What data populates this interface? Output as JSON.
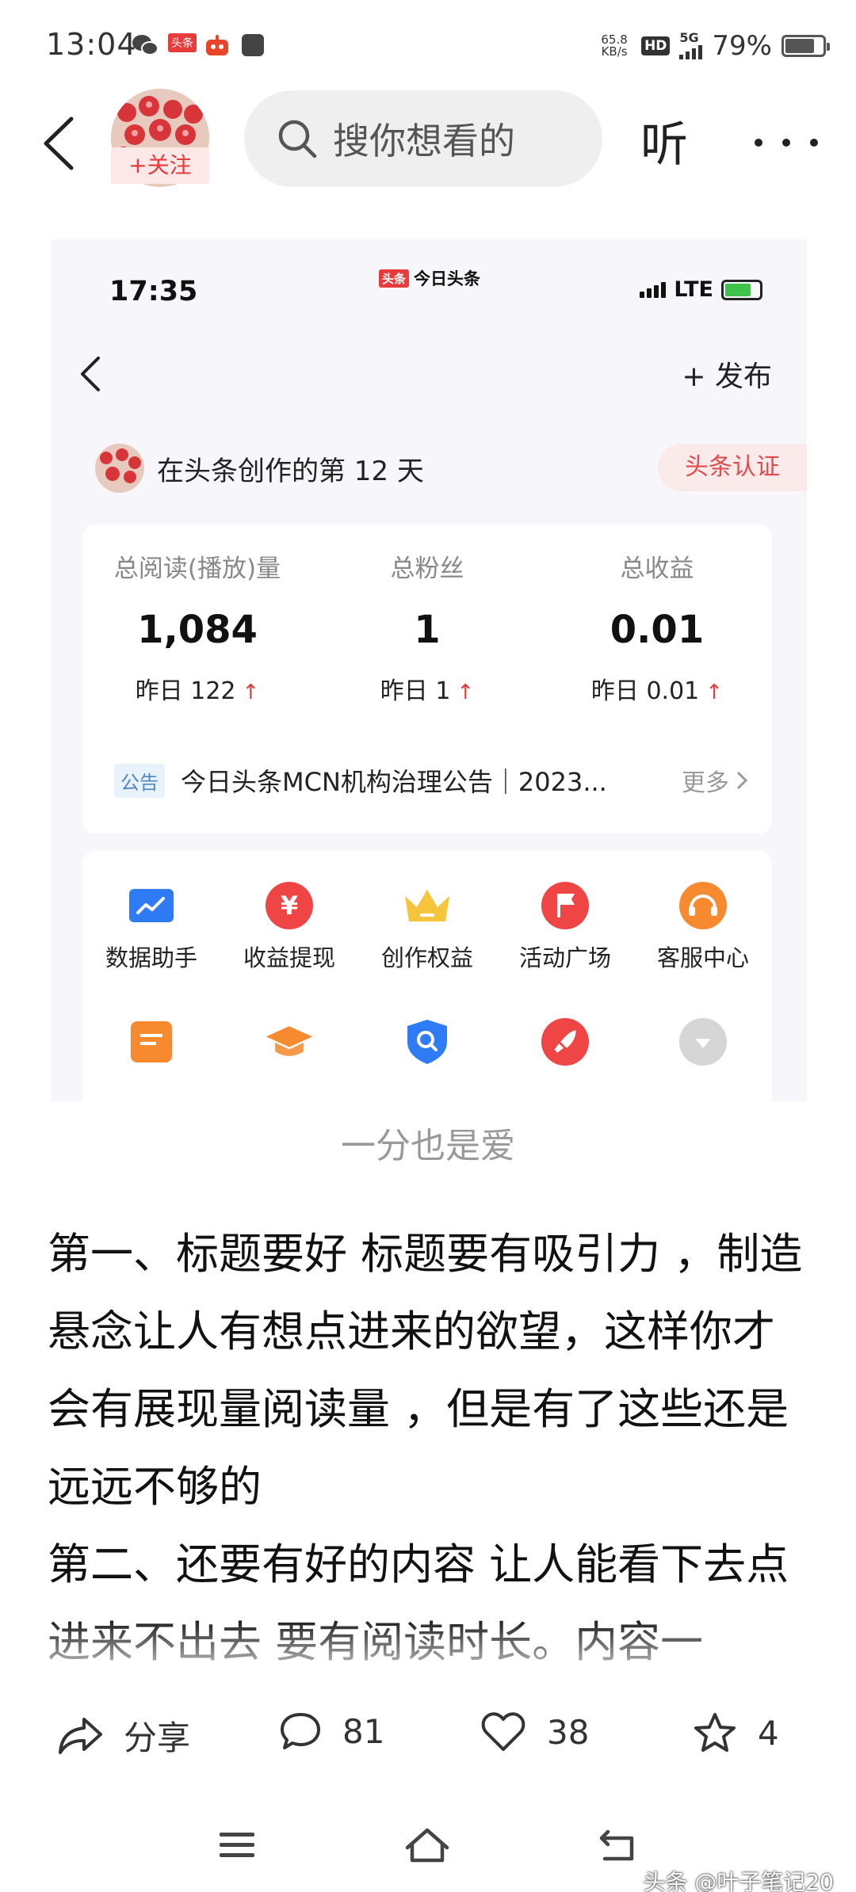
{
  "status_bar": {
    "time": "13:04",
    "app_badge": "头条",
    "net_speed_value": "65.8",
    "net_speed_unit": "KB/s",
    "hd": "HD",
    "network": "5G",
    "battery_percent": "79%",
    "battery_level": 0.79
  },
  "header": {
    "follow_label": "+关注",
    "search_placeholder": "搜你想看的",
    "listen_label": "听"
  },
  "screenshot": {
    "time": "17:35",
    "app_badge": "头条",
    "app_name": "今日头条",
    "network": "LTE",
    "publish_label": "+ 发布",
    "creation_days": "在头条创作的第 12 天",
    "cert_label": "头条认证",
    "stats": [
      {
        "label": "总阅读(播放)量",
        "value": "1,084",
        "yesterday": "昨日 122"
      },
      {
        "label": "总粉丝",
        "value": "1",
        "yesterday": "昨日 1"
      },
      {
        "label": "总收益",
        "value": "0.01",
        "yesterday": "昨日 0.01"
      }
    ],
    "notice": {
      "tag": "公告",
      "text": "今日头条MCN机构治理公告｜2023...",
      "more": "更多"
    },
    "tools": [
      {
        "label": "数据助手",
        "icon": "chart-icon",
        "color": "#2f7bf5"
      },
      {
        "label": "收益提现",
        "icon": "yuan-icon",
        "color": "#f04545"
      },
      {
        "label": "创作权益",
        "icon": "crown-icon",
        "color": "#f7c53b"
      },
      {
        "label": "活动广场",
        "icon": "flag-icon",
        "color": "#f04545"
      },
      {
        "label": "客服中心",
        "icon": "headset-icon",
        "color": "#f7892f"
      }
    ],
    "tools_row2": [
      {
        "icon": "document-icon",
        "color": "#f7892f"
      },
      {
        "icon": "graduation-cap-icon",
        "color": "#f7892f"
      },
      {
        "icon": "search-shield-icon",
        "color": "#2f7bf5"
      },
      {
        "icon": "rocket-icon",
        "color": "#f04545"
      },
      {
        "icon": "chevron-down-icon",
        "color": "#bdbdbd"
      }
    ]
  },
  "caption": "一分也是爱",
  "article": {
    "paragraph1": "第一、标题要好 标题要有吸引力 ，制造悬念让人有想点进来的欲望，这样你才会有展现量阅读量 ，但是有了这些还是远远不够的",
    "paragraph2": "第二、还要有好的内容 让人能看下去点进来不出去 要有阅读时长。内容一"
  },
  "actions": {
    "share": "分享",
    "comments": "81",
    "likes": "38",
    "favorites": "4"
  },
  "watermark": "头条 @叶子笔记20",
  "colors": {
    "accent_red": "#e43b3b",
    "search_bg": "#efefef",
    "card_bg": "#ffffff",
    "screenshot_bg": "#f7f6fa"
  }
}
